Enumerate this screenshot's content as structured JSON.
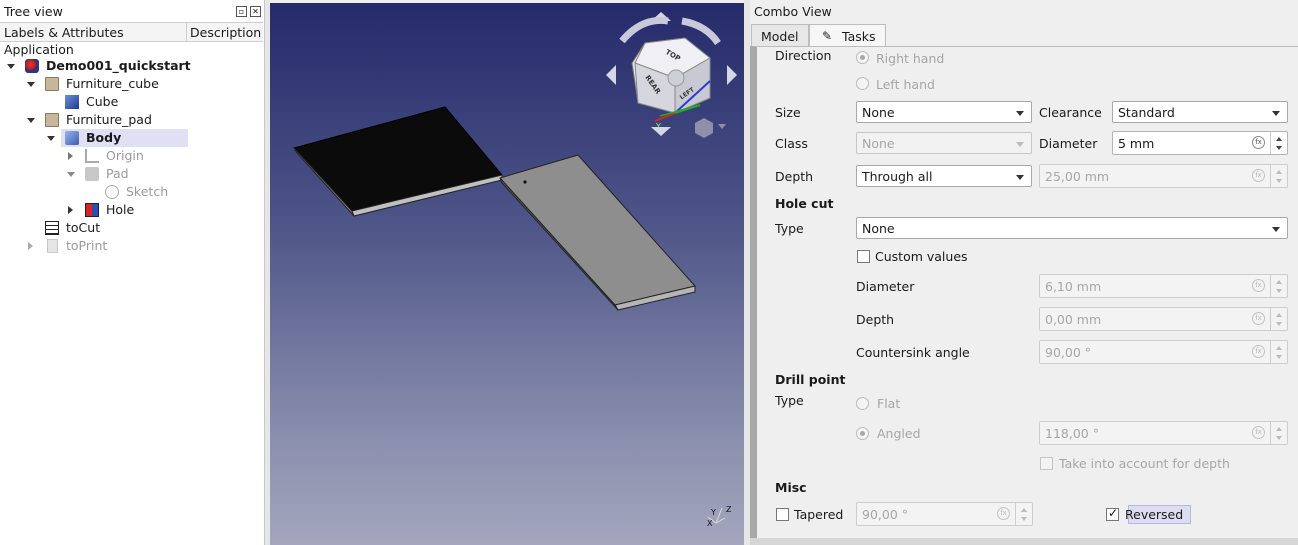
{
  "tree": {
    "title": "Tree view",
    "header": {
      "labels": "Labels & Attributes",
      "description": "Description"
    },
    "root": "Application",
    "items": [
      {
        "label": "Demo001_quickstart",
        "icon": "document-icon"
      },
      {
        "label": "Furniture_cube",
        "icon": "folder-icon"
      },
      {
        "label": "Cube",
        "icon": "cube-icon"
      },
      {
        "label": "Furniture_pad",
        "icon": "folder-icon"
      },
      {
        "label": "Body",
        "icon": "body-icon"
      },
      {
        "label": "Origin",
        "icon": "origin-icon"
      },
      {
        "label": "Pad",
        "icon": "pad-icon"
      },
      {
        "label": "Sketch",
        "icon": "sketch-icon"
      },
      {
        "label": "Hole",
        "icon": "hole-icon"
      },
      {
        "label": "toCut",
        "icon": "spreadsheet-icon"
      },
      {
        "label": "toPrint",
        "icon": "page-icon"
      }
    ]
  },
  "view3d": {
    "navcube": {
      "faces": [
        "TOP",
        "REAR",
        "LEFT"
      ]
    },
    "axes": [
      "X",
      "Y",
      "Z"
    ]
  },
  "combo": {
    "title": "Combo View",
    "tabs": [
      {
        "label": "Model"
      },
      {
        "label": "Tasks"
      }
    ],
    "direction": {
      "label": "Direction",
      "right_hand": "Right hand",
      "left_hand": "Left hand"
    },
    "size": {
      "label": "Size",
      "value": "None"
    },
    "clearance": {
      "label": "Clearance",
      "value": "Standard"
    },
    "class": {
      "label": "Class",
      "value": "None"
    },
    "diameter": {
      "label": "Diameter",
      "value": "5 mm"
    },
    "depth": {
      "label": "Depth",
      "mode": "Through all",
      "value": "25,00 mm"
    },
    "hole_cut": {
      "heading": "Hole cut",
      "type_label": "Type",
      "type_value": "None",
      "custom_values": "Custom values",
      "diameter_label": "Diameter",
      "diameter_value": "6,10 mm",
      "depth_label": "Depth",
      "depth_value": "0,00 mm",
      "countersink_label": "Countersink angle",
      "countersink_value": "90,00 °"
    },
    "drill_point": {
      "heading": "Drill point",
      "type_label": "Type",
      "flat": "Flat",
      "angled": "Angled",
      "angle_value": "118,00 °",
      "take_into_account": "Take into account for depth"
    },
    "misc": {
      "heading": "Misc",
      "tapered": "Tapered",
      "tapered_value": "90,00 °",
      "reversed": "Reversed"
    }
  }
}
